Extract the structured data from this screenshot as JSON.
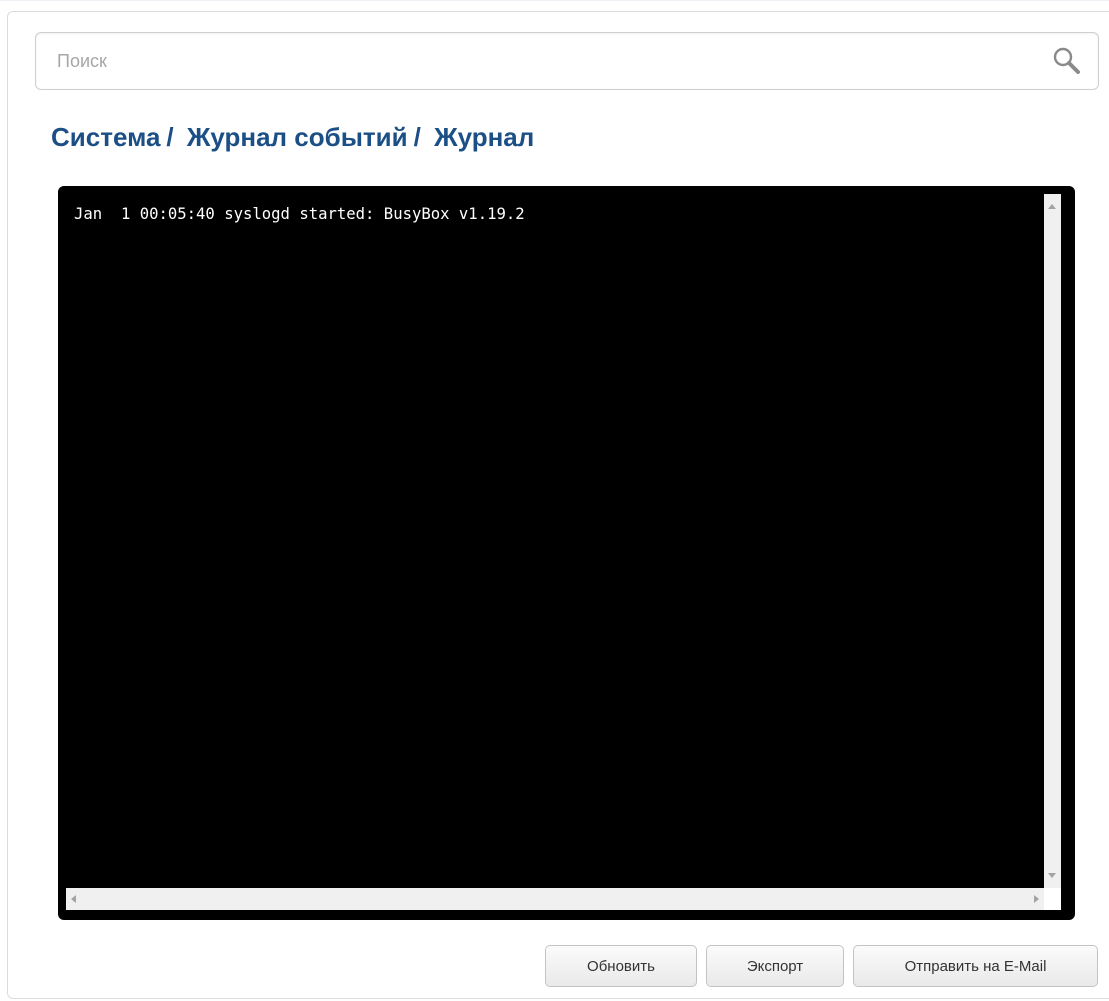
{
  "search": {
    "placeholder": "Поиск",
    "value": "",
    "icon": "search-icon"
  },
  "breadcrumb": {
    "items": [
      "Система",
      "Журнал событий",
      "Журнал"
    ],
    "separator": "/"
  },
  "log": {
    "lines": [
      "Jan  1 00:05:40 syslogd started: BusyBox v1.19.2"
    ]
  },
  "buttons": {
    "refresh_label": "Обновить",
    "export_label": "Экспорт",
    "email_label": "Отправить на E-Mail"
  },
  "colors": {
    "breadcrumb": "#1b4f86",
    "log_background": "#000000",
    "log_text": "#ffffff"
  }
}
